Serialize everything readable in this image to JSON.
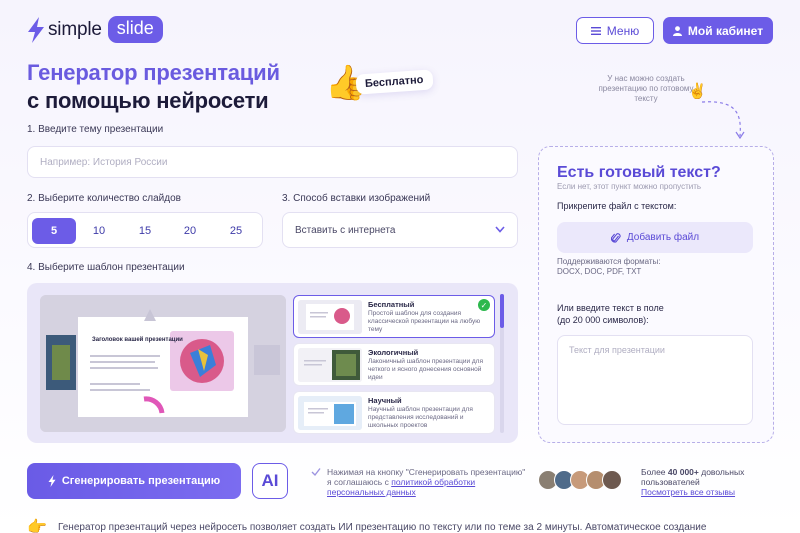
{
  "header": {
    "logo_simple": "simple",
    "logo_slide": "slide",
    "menu_label": "Меню",
    "cabinet_label": "Мой кабинет"
  },
  "hero": {
    "title_line1": "Генератор презентаций",
    "title_line2": "с помощью нейросети",
    "free_badge": "Бесплатно",
    "hint": "У нас можно создать презентацию по готовому тексту"
  },
  "form": {
    "topic_label": "1. Введите тему презентации",
    "topic_placeholder": "Например: История России",
    "count_label": "2. Выберите количество слайдов",
    "count_options": [
      "5",
      "10",
      "15",
      "20",
      "25"
    ],
    "count_selected": "5",
    "image_label": "3. Способ вставки изображений",
    "image_value": "Вставить с интернета",
    "template_label": "4. Выберите шаблон презентации"
  },
  "preview": {
    "slide_title": "Заголовок вашей презентации"
  },
  "templates": [
    {
      "title": "Бесплатный",
      "desc": "Простой шаблон для создания классической презентации на любую тему",
      "selected": true
    },
    {
      "title": "Экологичный",
      "desc": "Лаконичный шаблон презентации для четкого и ясного донесения основной идеи",
      "selected": false
    },
    {
      "title": "Научный",
      "desc": "Научный шаблон презентации для представления исследований и школьных проектов",
      "selected": false
    }
  ],
  "panel": {
    "title": "Есть готовый текст?",
    "subtitle": "Если нет, этот пункт можно пропустить",
    "attach_label": "Прикрепите файл с текстом:",
    "add_file": "Добавить файл",
    "formats_line1": "Поддерживаются форматы:",
    "formats_line2": "DOCX, DOC, PDF, TXT",
    "or_text_line1": "Или введите текст в поле",
    "or_text_line2": "(до 20 000 символов):",
    "textarea_placeholder": "Текст для презентации"
  },
  "bottom": {
    "generate_label": "Сгенерировать презентацию",
    "ai_badge": "AI",
    "consent_text": "Нажимая на кнопку \"Сгенерировать презентацию\" я соглашаюсь с ",
    "consent_link": "политикой обработки персональных данных",
    "users_prefix": "Более ",
    "users_count": "40 000+",
    "users_suffix": " довольных пользователей",
    "reviews_link": "Посмотреть все отзывы",
    "footer_text": "Генератор презентаций через нейросеть позволяет создать ИИ презентацию по тексту или по теме за 2 минуты. Автоматическое создание"
  },
  "colors": {
    "accent": "#6c5ce7",
    "check_green": "#2db84d"
  }
}
